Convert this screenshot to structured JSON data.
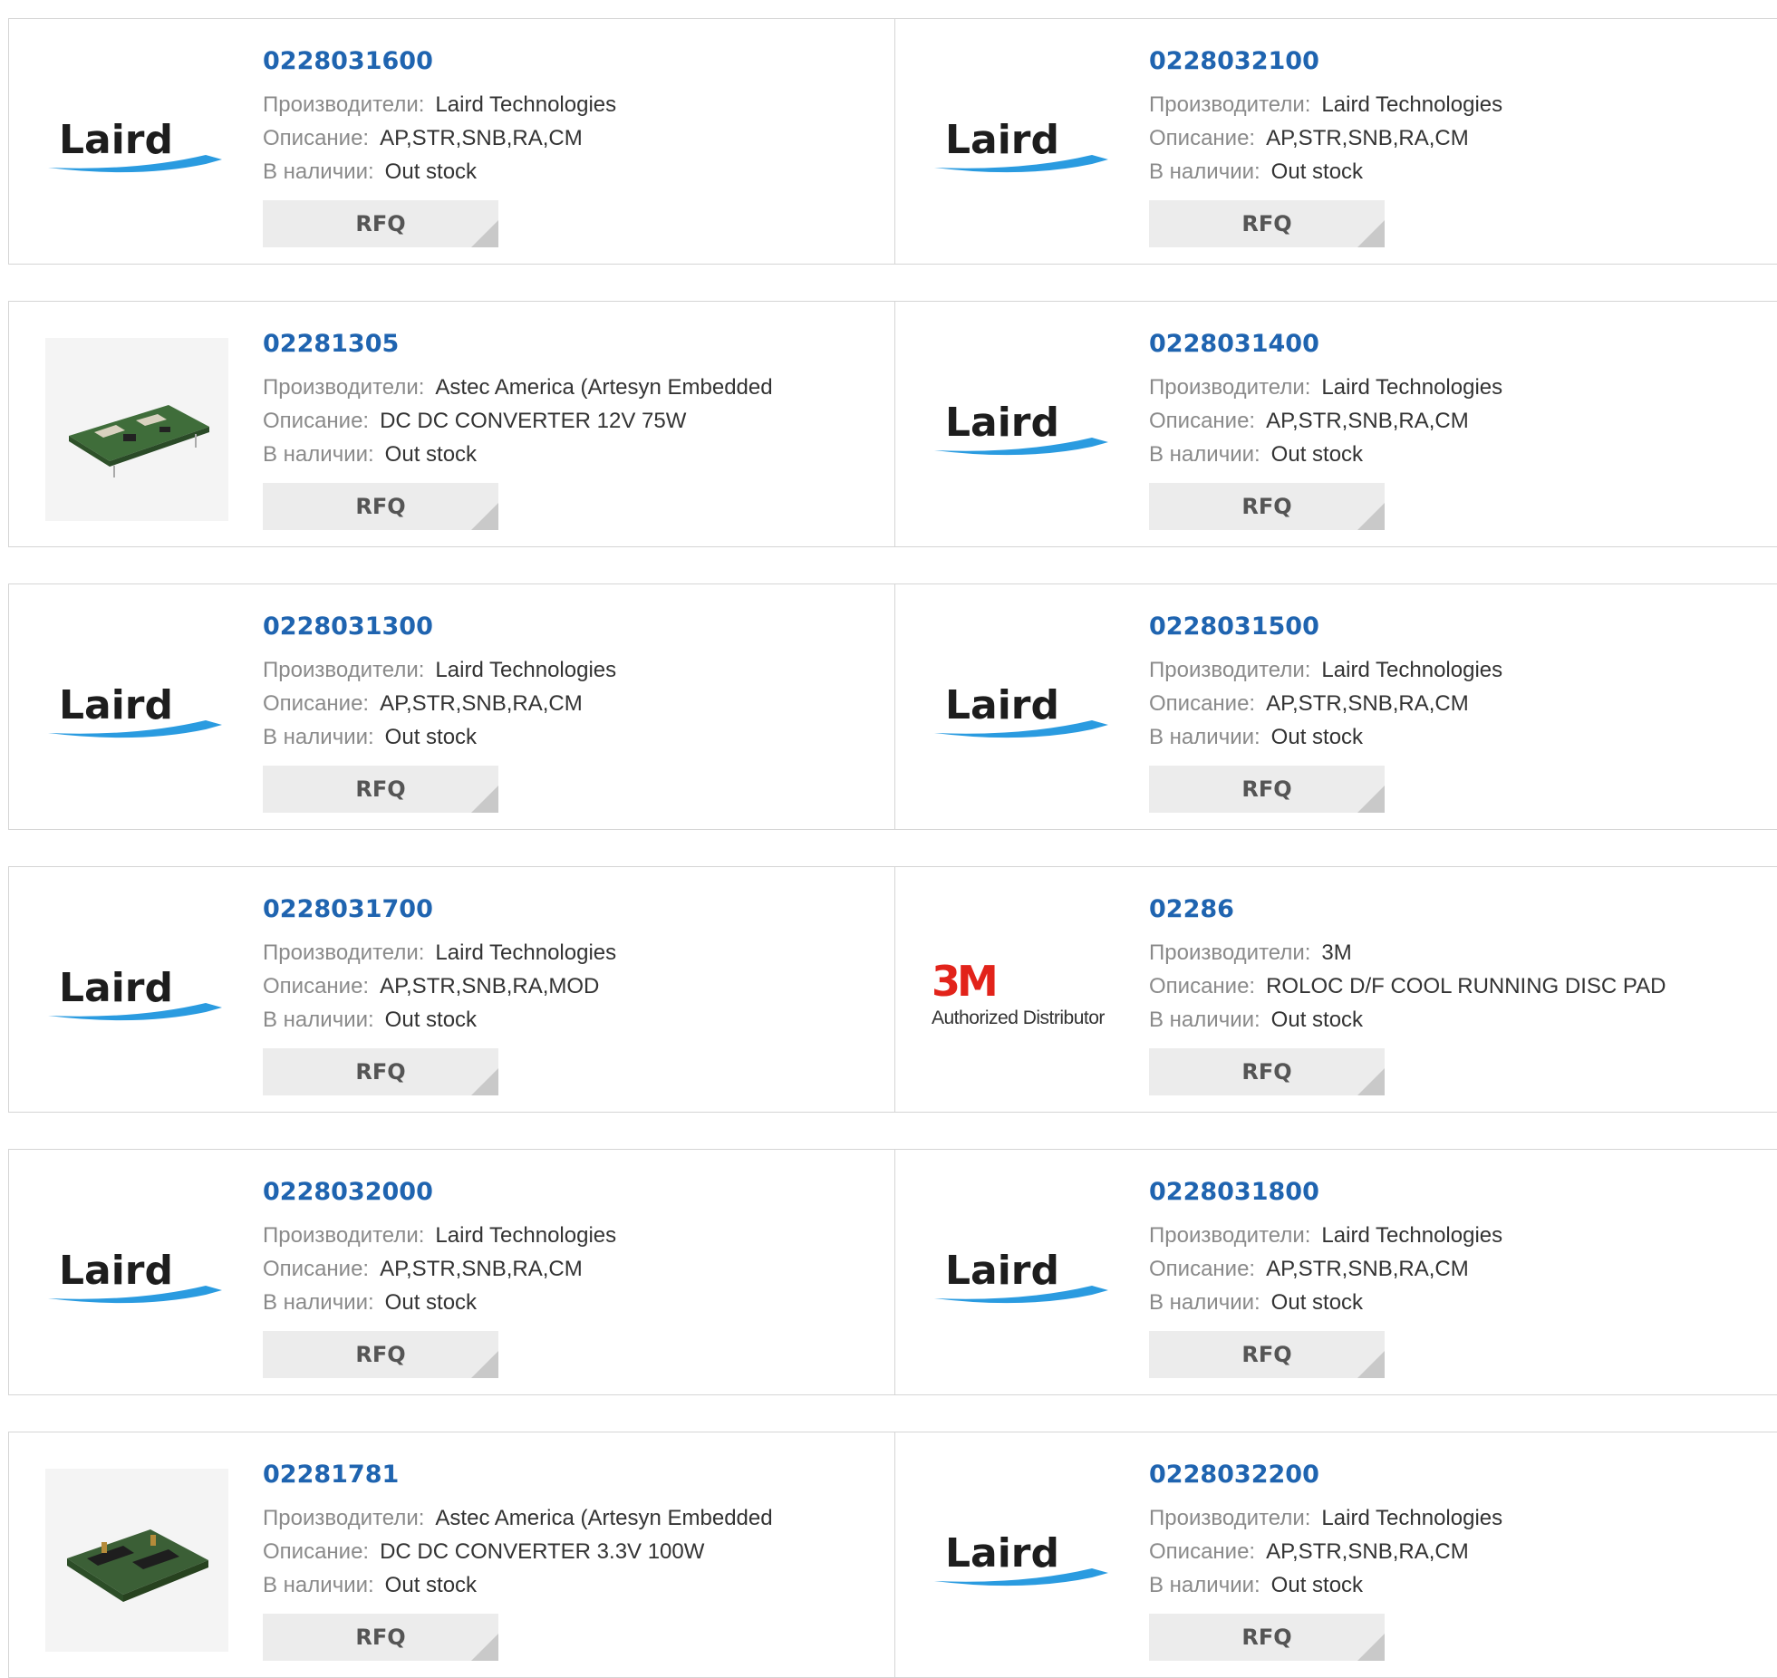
{
  "labels": {
    "manufacturer": "Производители:",
    "description": "Описание:",
    "stock": "В наличии:",
    "rfq": "RFQ"
  },
  "colors": {
    "part_link": "#1f64b0",
    "label_gray": "#8a8a8a",
    "button_bg": "#ececec",
    "logo_3m_red": "#e2231a"
  },
  "rows": [
    [
      {
        "part": "0228031600",
        "manufacturer": "Laird Technologies",
        "description": "AP,STR,SNB,RA,CM",
        "stock": "Out stock",
        "logo": "laird",
        "logo_text": "Laird"
      },
      {
        "part": "0228032100",
        "manufacturer": "Laird Technologies",
        "description": "AP,STR,SNB,RA,CM",
        "stock": "Out stock",
        "logo": "laird",
        "logo_text": "Laird"
      }
    ],
    [
      {
        "part": "02281305",
        "manufacturer": "Astec America (Artesyn Embedded",
        "description": "DC DC CONVERTER 12V 75W",
        "stock": "Out stock",
        "logo": "photo-converter-a"
      },
      {
        "part": "0228031400",
        "manufacturer": "Laird Technologies",
        "description": "AP,STR,SNB,RA,CM",
        "stock": "Out stock",
        "logo": "laird",
        "logo_text": "Laird"
      }
    ],
    [
      {
        "part": "0228031300",
        "manufacturer": "Laird Technologies",
        "description": "AP,STR,SNB,RA,CM",
        "stock": "Out stock",
        "logo": "laird",
        "logo_text": "Laird"
      },
      {
        "part": "0228031500",
        "manufacturer": "Laird Technologies",
        "description": "AP,STR,SNB,RA,CM",
        "stock": "Out stock",
        "logo": "laird",
        "logo_text": "Laird"
      }
    ],
    [
      {
        "part": "0228031700",
        "manufacturer": "Laird Technologies",
        "description": "AP,STR,SNB,RA,MOD",
        "stock": "Out stock",
        "logo": "laird",
        "logo_text": "Laird"
      },
      {
        "part": "02286",
        "manufacturer": "3M",
        "description": "ROLOC D/F COOL RUNNING DISC PAD",
        "stock": "Out stock",
        "logo": "3m",
        "logo_text": "3M",
        "logo_subtext": "Authorized Distributor"
      }
    ],
    [
      {
        "part": "0228032000",
        "manufacturer": "Laird Technologies",
        "description": "AP,STR,SNB,RA,CM",
        "stock": "Out stock",
        "logo": "laird",
        "logo_text": "Laird"
      },
      {
        "part": "0228031800",
        "manufacturer": "Laird Technologies",
        "description": "AP,STR,SNB,RA,CM",
        "stock": "Out stock",
        "logo": "laird",
        "logo_text": "Laird"
      }
    ],
    [
      {
        "part": "02281781",
        "manufacturer": "Astec America (Artesyn Embedded",
        "description": "DC DC CONVERTER 3.3V 100W",
        "stock": "Out stock",
        "logo": "photo-converter-b"
      },
      {
        "part": "0228032200",
        "manufacturer": "Laird Technologies",
        "description": "AP,STR,SNB,RA,CM",
        "stock": "Out stock",
        "logo": "laird",
        "logo_text": "Laird"
      }
    ]
  ]
}
